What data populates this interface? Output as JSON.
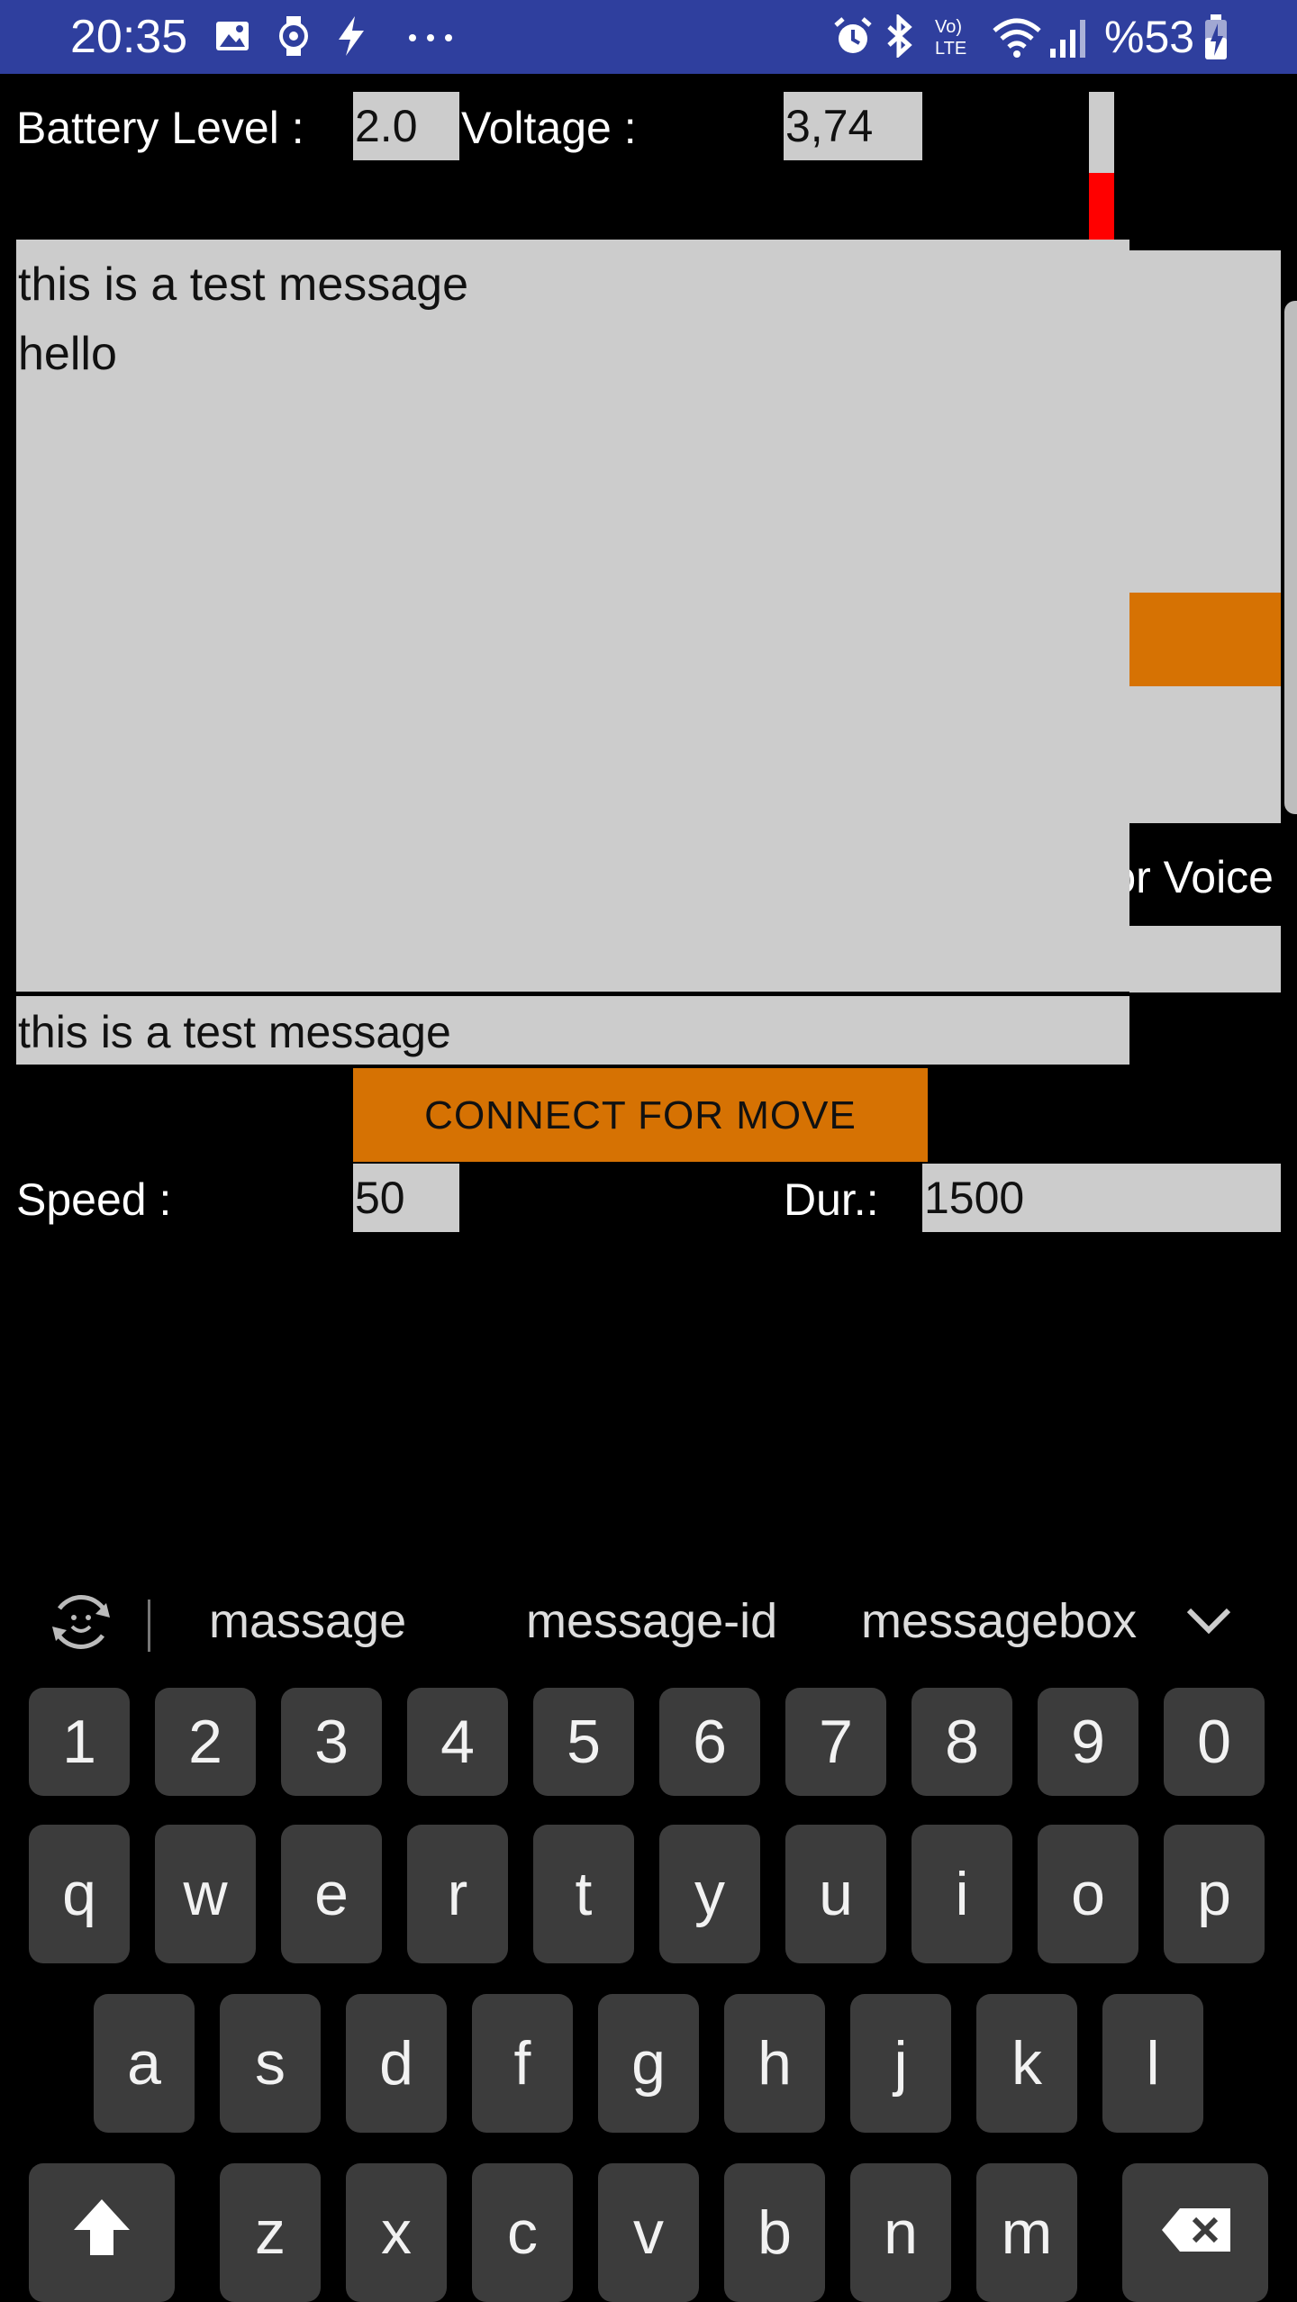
{
  "status_bar": {
    "time": "20:35",
    "battery_percent": "%53",
    "left_icons": [
      "gallery-icon",
      "watch-icon",
      "flash-icon",
      "more-icon"
    ],
    "right_icons": [
      "alarm-icon",
      "bluetooth-icon",
      "volte-icon",
      "wifi-icon",
      "signal-icon",
      "battery-icon"
    ]
  },
  "battery": {
    "level_label": "Battery Level :",
    "level_value": "2.0",
    "voltage_label": "Voltage :",
    "voltage_value": "3,74",
    "bar_fill_fraction": 0.45,
    "bar_fill_color": "#ff0000"
  },
  "message_area": {
    "lines": [
      "this is a test message",
      "hello"
    ]
  },
  "hidden_panel": {
    "partial_label": "or Voice"
  },
  "message_input": {
    "value": "this is a test message"
  },
  "connect_button": {
    "label": "CONNECT FOR MOVE"
  },
  "motion": {
    "speed_label": "Speed :",
    "speed_value": "50",
    "duration_label": "Dur.:",
    "duration_value": "1500"
  },
  "keyboard": {
    "suggestions": [
      "massage",
      "message-id",
      "messagebox"
    ],
    "number_row": [
      "1",
      "2",
      "3",
      "4",
      "5",
      "6",
      "7",
      "8",
      "9",
      "0"
    ],
    "row1": [
      "q",
      "w",
      "e",
      "r",
      "t",
      "y",
      "u",
      "i",
      "o",
      "p"
    ],
    "row2": [
      "a",
      "s",
      "d",
      "f",
      "g",
      "h",
      "j",
      "k",
      "l"
    ],
    "row3": [
      "z",
      "x",
      "c",
      "v",
      "b",
      "n",
      "m"
    ]
  },
  "colors": {
    "status_bar": "#2f3f9e",
    "accent_orange": "#d67203",
    "field_grey": "#cccccc",
    "key_grey": "#3c3c3c"
  }
}
